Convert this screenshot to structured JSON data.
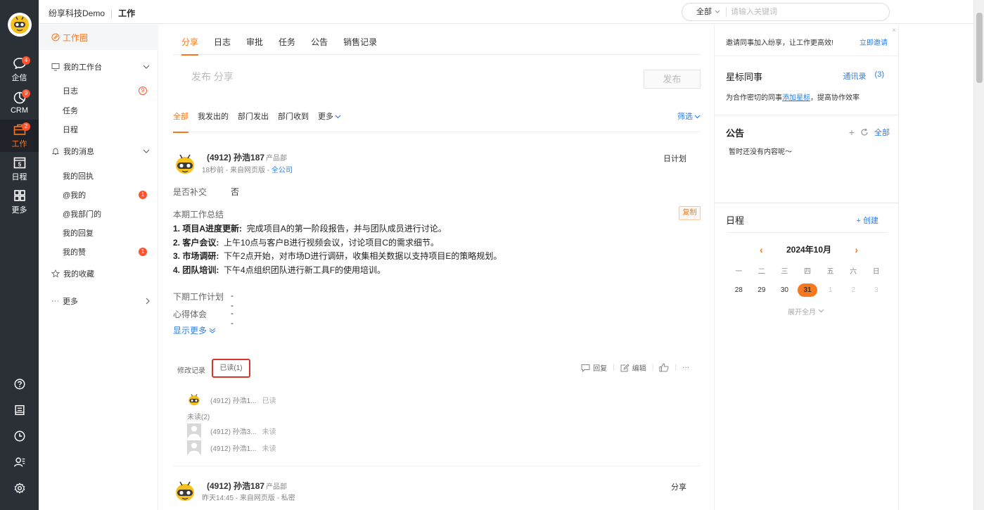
{
  "rail": {
    "items": [
      {
        "label": "企信",
        "badge": "4"
      },
      {
        "label": "CRM",
        "badge": "9"
      },
      {
        "label": "工作",
        "badge": "2"
      },
      {
        "label": "日程",
        "badge": ""
      },
      {
        "label": "更多",
        "badge": ""
      }
    ],
    "calendar_day": "5"
  },
  "header": {
    "company": "纷享科技Demo",
    "page": "工作",
    "search_scope": "全部",
    "search_placeholder": "请输入关键词"
  },
  "subnav": {
    "active": "工作圈",
    "my_workbench": "我的工作台",
    "workbench_items": [
      {
        "label": "日志",
        "badge": "9"
      },
      {
        "label": "任务",
        "badge": ""
      },
      {
        "label": "日程",
        "badge": ""
      }
    ],
    "my_messages": "我的消息",
    "message_items": [
      {
        "label": "我的回执",
        "badge": ""
      },
      {
        "label": "@我的",
        "badge": "1"
      },
      {
        "label": "@我部门的",
        "badge": ""
      },
      {
        "label": "我的回复",
        "badge": ""
      },
      {
        "label": "我的赞",
        "badge": "1"
      }
    ],
    "favorites": "我的收藏",
    "more": "更多"
  },
  "main": {
    "tabs": [
      "分享",
      "日志",
      "审批",
      "任务",
      "公告",
      "销售记录"
    ],
    "composer_placeholder": "发布 分享",
    "publish": "发布",
    "filters": [
      "全部",
      "我发出的",
      "部门发出",
      "部门收到"
    ],
    "filter_more": "更多",
    "filter_screen": "筛选",
    "post1": {
      "name": "(4912) 孙浩187",
      "dept": "产品部",
      "meta_time": "18秒前 - 来自网页版 - ",
      "meta_scope": "全公司",
      "type": "日计划",
      "supplement_label": "是否补交",
      "supplement_value": "否",
      "summary_label": "本期工作总结",
      "copy": "复制",
      "lines": [
        {
          "head": "1. 项目A进度更新:",
          "body": "完成项目A的第一阶段报告，并与团队成员进行讨论。"
        },
        {
          "head": "2. 客户会议:",
          "body": "上午10点与客户B进行视频会议，讨论项目C的需求细节。"
        },
        {
          "head": "3. 市场调研:",
          "body": "下午2点开始，对市场D进行调研，收集相关数据以支持项目E的策略规划。"
        },
        {
          "head": "4. 团队培训:",
          "body": "下午4点组织团队进行新工具F的使用培训。"
        }
      ],
      "next_plan_label": "下期工作计划",
      "next_plan_value": "--",
      "insight_label": "心得体会",
      "insight_value": "--",
      "show_more": "显示更多",
      "history": "修改记录",
      "read": "已读(1)",
      "reply": "回复",
      "edit": "编辑",
      "more_dots": "···",
      "readers": [
        {
          "name": "(4912) 孙浩1...",
          "status": "已读"
        }
      ],
      "unread_label": "未读(2)",
      "unreaders": [
        {
          "name": "(4912) 孙浩3...",
          "status": "未读"
        },
        {
          "name": "(4912) 孙浩1...",
          "status": "未读"
        }
      ]
    },
    "post2": {
      "name": "(4912) 孙浩187",
      "dept": "产品部",
      "meta": "昨天14:45 - 来自网页版 - 私密",
      "type": "分享"
    }
  },
  "right": {
    "invite_text": "邀请同事加入纷享，让工作更高效!",
    "invite_link": "立即邀请",
    "close": "×",
    "star_title": "星标同事",
    "contacts_link": "通讯录",
    "contacts_count": "(3)",
    "star_tip_pre": "为合作密切的同事",
    "star_tip_link": "添加星标",
    "star_tip_post": "，提高协作效率",
    "announce_title": "公告",
    "announce_all": "全部",
    "announce_empty": "暂时还没有内容呢～",
    "schedule_title": "日程",
    "schedule_create": "+ 创建",
    "month": "2024年10月",
    "weekdays": [
      "一",
      "二",
      "三",
      "四",
      "五",
      "六",
      "日"
    ],
    "days": [
      "28",
      "29",
      "30",
      "31",
      "1",
      "2",
      "3"
    ],
    "expand": "展开全月"
  },
  "colors": {
    "accent": "#f7781e",
    "link": "#2e7de1",
    "rail": "#2b3037",
    "badge": "#ff522d"
  }
}
